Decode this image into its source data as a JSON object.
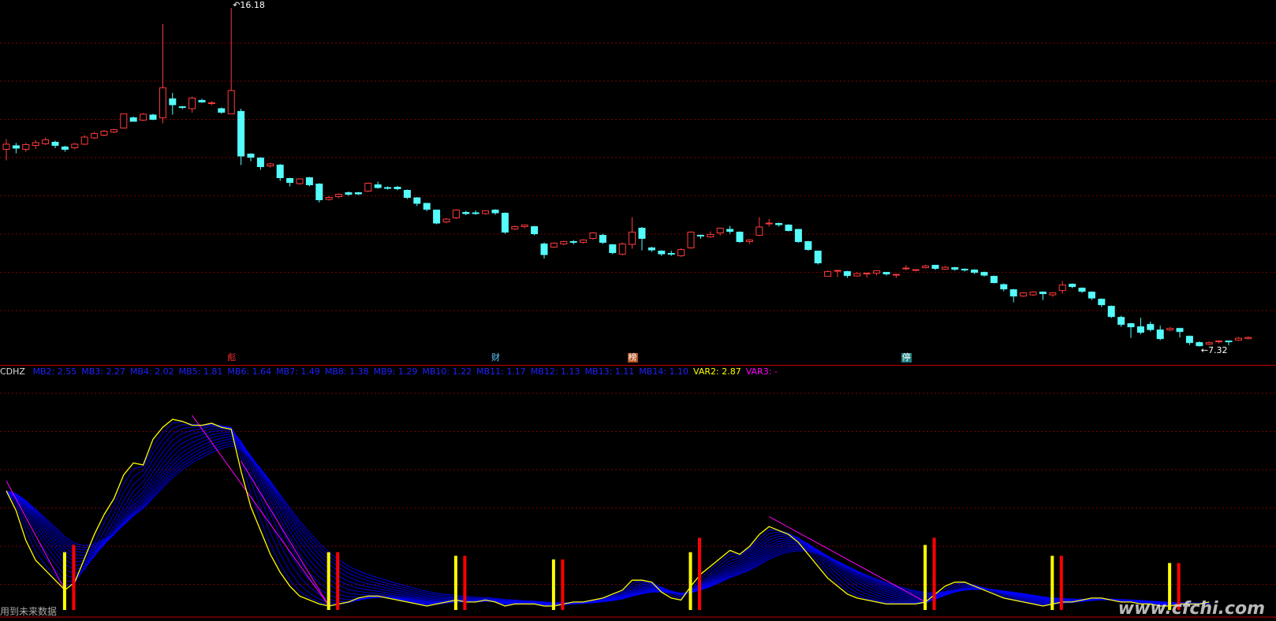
{
  "colors": {
    "up": "#ff3b3b",
    "down": "#54fcfc",
    "grid": "#7a0000",
    "divider": "#c00000",
    "mb": "#2020ff",
    "mbLine": "#0000ff",
    "var2": "#ffff00",
    "var3": "#ff00ff",
    "barYellow": "#ffff00",
    "barRed": "#ff0000"
  },
  "price": {
    "high_label": "16.18",
    "low_label": "7.32"
  },
  "event_markers": [
    {
      "label": "彪",
      "color": "#ff3030",
      "bg": "",
      "idx": 23
    },
    {
      "label": "财",
      "color": "#60c8ff",
      "bg": "",
      "idx": 50
    },
    {
      "label": "榜",
      "color": "#ffffff",
      "bg": "#b05020",
      "idx": 64
    },
    {
      "label": "停",
      "color": "#ffffff",
      "bg": "#208080",
      "idx": 92
    }
  ],
  "indicator": {
    "name": "CDHZ",
    "values": [
      {
        "label": "MB2: 2.55",
        "kind": "mb"
      },
      {
        "label": "MB3: 2.27",
        "kind": "mb"
      },
      {
        "label": "MB4: 2.02",
        "kind": "mb"
      },
      {
        "label": "MB5: 1.81",
        "kind": "mb"
      },
      {
        "label": "MB6: 1.64",
        "kind": "mb"
      },
      {
        "label": "MB7: 1.49",
        "kind": "mb"
      },
      {
        "label": "MB8: 1.38",
        "kind": "mb"
      },
      {
        "label": "MB9: 1.29",
        "kind": "mb"
      },
      {
        "label": "MB10: 1.22",
        "kind": "mb"
      },
      {
        "label": "MB11: 1.17",
        "kind": "mb"
      },
      {
        "label": "MB12: 1.13",
        "kind": "mb"
      },
      {
        "label": "MB13: 1.11",
        "kind": "mb"
      },
      {
        "label": "MB14: 1.10",
        "kind": "mb"
      },
      {
        "label": "VAR2: 2.87",
        "kind": "var2"
      },
      {
        "label": "VAR3: -",
        "kind": "var3"
      }
    ]
  },
  "signal_bars": [
    {
      "idx": 6,
      "yellow": 0.16,
      "red": 0.18
    },
    {
      "idx": 33,
      "yellow": 0.16,
      "red": 0.16
    },
    {
      "idx": 46,
      "yellow": 0.15,
      "red": 0.15
    },
    {
      "idx": 56,
      "yellow": 0.14,
      "red": 0.14
    },
    {
      "idx": 70,
      "yellow": 0.16,
      "red": 0.2
    },
    {
      "idx": 94,
      "yellow": 0.18,
      "red": 0.2
    },
    {
      "idx": 107,
      "yellow": 0.15,
      "red": 0.15
    },
    {
      "idx": 119,
      "yellow": 0.13,
      "red": 0.13
    }
  ],
  "footnote": "用到未来数据",
  "watermark": "www.cfchi.com",
  "chart_data": {
    "type": "candlestick",
    "title": "",
    "ohlc": [
      [
        11.92,
        12.05,
        11.64,
        12.18
      ],
      [
        12.01,
        11.95,
        11.82,
        12.08
      ],
      [
        11.92,
        12.04,
        11.86,
        12.08
      ],
      [
        12.02,
        12.09,
        11.93,
        12.15
      ],
      [
        12.06,
        12.16,
        12.03,
        12.22
      ],
      [
        12.1,
        12.02,
        11.95,
        12.14
      ],
      [
        11.98,
        11.92,
        11.86,
        12.01
      ],
      [
        11.96,
        12.05,
        11.92,
        12.08
      ],
      [
        12.05,
        12.23,
        12.03,
        12.28
      ],
      [
        12.21,
        12.32,
        12.18,
        12.36
      ],
      [
        12.28,
        12.38,
        12.25,
        12.41
      ],
      [
        12.36,
        12.42,
        12.33,
        12.44
      ],
      [
        12.46,
        12.82,
        12.45,
        12.83
      ],
      [
        12.72,
        12.63,
        12.63,
        12.75
      ],
      [
        12.66,
        12.81,
        12.64,
        12.84
      ],
      [
        12.79,
        12.68,
        12.66,
        12.82
      ],
      [
        12.72,
        13.48,
        12.58,
        15.1
      ],
      [
        13.2,
        13.05,
        12.8,
        13.35
      ],
      [
        13.0,
        12.98,
        12.94,
        13.02
      ],
      [
        12.95,
        13.22,
        12.85,
        13.26
      ],
      [
        13.16,
        13.12,
        13.1,
        13.2
      ],
      [
        13.09,
        13.1,
        13.04,
        13.14
      ],
      [
        12.95,
        12.86,
        12.82,
        12.98
      ],
      [
        12.82,
        13.41,
        12.86,
        15.5
      ],
      [
        12.88,
        11.75,
        11.52,
        12.95
      ],
      [
        11.8,
        11.72,
        11.62,
        11.82
      ],
      [
        11.7,
        11.48,
        11.4,
        11.72
      ],
      [
        11.5,
        11.55,
        11.46,
        11.58
      ],
      [
        11.52,
        11.2,
        11.12,
        11.55
      ],
      [
        11.18,
        11.08,
        10.98,
        11.2
      ],
      [
        11.05,
        11.17,
        11.02,
        11.18
      ],
      [
        11.2,
        11.02,
        10.98,
        11.22
      ],
      [
        11.04,
        10.64,
        10.57,
        11.06
      ],
      [
        10.65,
        10.7,
        10.62,
        10.74
      ],
      [
        10.72,
        10.78,
        10.68,
        10.8
      ],
      [
        10.82,
        10.78,
        10.74,
        10.85
      ],
      [
        10.82,
        10.79,
        10.76,
        10.84
      ],
      [
        10.86,
        11.06,
        10.84,
        11.08
      ],
      [
        11.02,
        10.95,
        10.92,
        11.1
      ],
      [
        10.95,
        10.93,
        10.9,
        10.98
      ],
      [
        10.96,
        10.92,
        10.88,
        10.99
      ],
      [
        10.88,
        10.7,
        10.66,
        10.9
      ],
      [
        10.69,
        10.55,
        10.48,
        10.71
      ],
      [
        10.55,
        10.4,
        10.35,
        10.56
      ],
      [
        10.38,
        10.05,
        10.02,
        10.38
      ],
      [
        10.08,
        10.15,
        10.04,
        10.18
      ],
      [
        10.18,
        10.38,
        10.15,
        10.4
      ],
      [
        10.32,
        10.29,
        10.25,
        10.36
      ],
      [
        10.31,
        10.29,
        10.26,
        10.37
      ],
      [
        10.29,
        10.36,
        10.26,
        10.37
      ],
      [
        10.38,
        10.31,
        10.26,
        10.4
      ],
      [
        10.3,
        9.82,
        9.78,
        10.32
      ],
      [
        9.9,
        9.96,
        9.88,
        9.99
      ],
      [
        9.96,
        10.0,
        9.92,
        10.01
      ],
      [
        9.96,
        9.78,
        9.74,
        9.98
      ],
      [
        9.52,
        9.25,
        9.15,
        9.56
      ],
      [
        9.44,
        9.54,
        9.42,
        9.56
      ],
      [
        9.52,
        9.58,
        9.49,
        9.6
      ],
      [
        9.58,
        9.56,
        9.51,
        9.62
      ],
      [
        9.56,
        9.62,
        9.53,
        9.64
      ],
      [
        9.66,
        9.8,
        9.63,
        9.82
      ],
      [
        9.74,
        9.56,
        9.52,
        9.78
      ],
      [
        9.5,
        9.3,
        9.26,
        9.52
      ],
      [
        9.26,
        9.52,
        9.23,
        9.56
      ],
      [
        9.51,
        9.82,
        9.4,
        10.2
      ],
      [
        9.92,
        9.66,
        9.36,
        9.95
      ],
      [
        9.42,
        9.37,
        9.32,
        9.45
      ],
      [
        9.34,
        9.27,
        9.22,
        9.36
      ],
      [
        9.28,
        9.26,
        9.22,
        9.35
      ],
      [
        9.22,
        9.38,
        9.19,
        9.41
      ],
      [
        9.42,
        9.82,
        9.4,
        9.84
      ],
      [
        9.74,
        9.73,
        9.65,
        9.76
      ],
      [
        9.7,
        9.76,
        9.68,
        9.84
      ],
      [
        9.8,
        9.92,
        9.73,
        9.93
      ],
      [
        9.89,
        9.84,
        9.78,
        9.98
      ],
      [
        9.82,
        9.58,
        9.55,
        9.84
      ],
      [
        9.58,
        9.62,
        9.52,
        9.64
      ],
      [
        9.74,
        9.95,
        9.72,
        10.2
      ],
      [
        10.04,
        10.05,
        9.96,
        10.15
      ],
      [
        10.04,
        10.01,
        9.96,
        10.06
      ],
      [
        10.0,
        9.86,
        9.84,
        10.02
      ],
      [
        9.89,
        9.58,
        9.55,
        9.9
      ],
      [
        9.58,
        9.38,
        9.35,
        9.6
      ],
      [
        9.34,
        9.04,
        9.0,
        9.35
      ],
      [
        8.7,
        8.82,
        8.7,
        8.85
      ],
      [
        8.84,
        8.85,
        8.68,
        8.86
      ],
      [
        8.82,
        8.72,
        8.66,
        8.84
      ],
      [
        8.71,
        8.77,
        8.69,
        8.8
      ],
      [
        8.76,
        8.78,
        8.67,
        8.79
      ],
      [
        8.78,
        8.84,
        8.72,
        8.85
      ],
      [
        8.8,
        8.76,
        8.72,
        8.81
      ],
      [
        8.74,
        8.75,
        8.66,
        8.76
      ],
      [
        8.9,
        8.91,
        8.85,
        8.98
      ],
      [
        8.87,
        8.87,
        8.83,
        8.88
      ],
      [
        8.92,
        8.96,
        8.9,
        8.99
      ],
      [
        8.98,
        8.9,
        8.86,
        8.99
      ],
      [
        8.88,
        8.93,
        8.86,
        8.96
      ],
      [
        8.92,
        8.88,
        8.84,
        8.94
      ],
      [
        8.88,
        8.86,
        8.82,
        8.9
      ],
      [
        8.86,
        8.8,
        8.76,
        8.88
      ],
      [
        8.8,
        8.73,
        8.69,
        8.82
      ],
      [
        8.7,
        8.54,
        8.52,
        8.72
      ],
      [
        8.49,
        8.38,
        8.32,
        8.52
      ],
      [
        8.36,
        8.2,
        8.04,
        8.38
      ],
      [
        8.2,
        8.28,
        8.18,
        8.3
      ],
      [
        8.23,
        8.3,
        8.2,
        8.32
      ],
      [
        8.3,
        8.26,
        8.1,
        8.32
      ],
      [
        8.23,
        8.28,
        8.18,
        8.3
      ],
      [
        8.34,
        8.48,
        8.26,
        8.58
      ],
      [
        8.5,
        8.44,
        8.4,
        8.52
      ],
      [
        8.4,
        8.32,
        8.28,
        8.42
      ],
      [
        8.3,
        8.15,
        8.1,
        8.32
      ],
      [
        8.12,
        7.98,
        7.92,
        8.14
      ],
      [
        7.94,
        7.68,
        7.64,
        7.96
      ],
      [
        7.66,
        7.48,
        7.42,
        7.7
      ],
      [
        7.5,
        7.42,
        7.14,
        7.52
      ],
      [
        7.42,
        7.28,
        7.23,
        7.65
      ],
      [
        7.48,
        7.35,
        7.3,
        7.55
      ],
      [
        7.34,
        7.12,
        7.08,
        7.45
      ],
      [
        7.34,
        7.38,
        7.31,
        7.41
      ],
      [
        7.38,
        7.3,
        7.15,
        7.38
      ],
      [
        7.18,
        7.02,
        6.96,
        7.2
      ],
      [
        7.02,
        6.94,
        6.92,
        7.05
      ],
      [
        6.98,
        7.02,
        6.96,
        7.05
      ],
      [
        7.04,
        7.06,
        7.0,
        7.08
      ],
      [
        7.06,
        7.04,
        6.95,
        7.07
      ],
      [
        7.08,
        7.13,
        7.06,
        7.16
      ],
      [
        7.12,
        7.15,
        7.1,
        7.18
      ]
    ],
    "indicator": {
      "VAR2": [
        0.6,
        0.5,
        0.35,
        0.25,
        0.2,
        0.15,
        0.1,
        0.14,
        0.26,
        0.38,
        0.48,
        0.56,
        0.68,
        0.74,
        0.73,
        0.86,
        0.92,
        0.96,
        0.95,
        0.93,
        0.93,
        0.94,
        0.92,
        0.91,
        0.7,
        0.52,
        0.4,
        0.28,
        0.19,
        0.12,
        0.07,
        0.05,
        0.03,
        0.02,
        0.03,
        0.04,
        0.06,
        0.07,
        0.07,
        0.06,
        0.05,
        0.04,
        0.03,
        0.02,
        0.03,
        0.04,
        0.05,
        0.04,
        0.04,
        0.05,
        0.04,
        0.02,
        0.03,
        0.03,
        0.03,
        0.02,
        0.02,
        0.03,
        0.04,
        0.04,
        0.05,
        0.06,
        0.08,
        0.1,
        0.15,
        0.15,
        0.14,
        0.09,
        0.06,
        0.05,
        0.12,
        0.18,
        0.22,
        0.26,
        0.3,
        0.28,
        0.32,
        0.38,
        0.42,
        0.4,
        0.38,
        0.34,
        0.28,
        0.22,
        0.16,
        0.12,
        0.08,
        0.06,
        0.05,
        0.04,
        0.03,
        0.03,
        0.03,
        0.03,
        0.04,
        0.08,
        0.12,
        0.14,
        0.14,
        0.12,
        0.1,
        0.08,
        0.06,
        0.05,
        0.04,
        0.03,
        0.02,
        0.03,
        0.04,
        0.04,
        0.05,
        0.06,
        0.06,
        0.05,
        0.04,
        0.04,
        0.03,
        0.03,
        0.02,
        0.02,
        0.03,
        0.03,
        0.03,
        0.04
      ]
    }
  }
}
